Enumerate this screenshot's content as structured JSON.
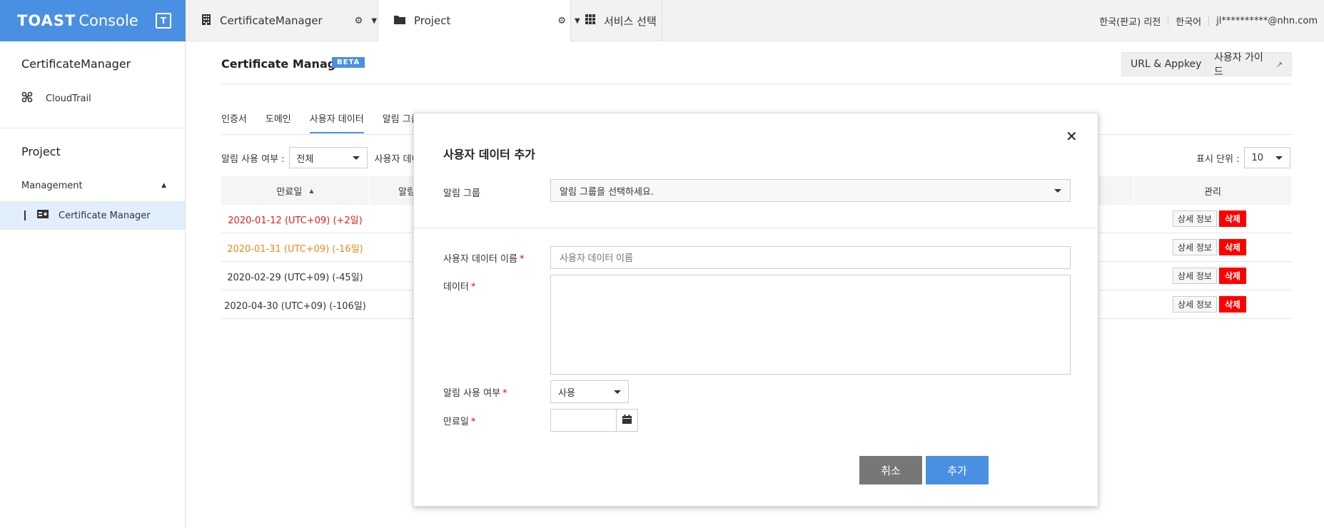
{
  "topbar": {
    "logo_toast": "TOAST",
    "logo_console": "Console",
    "logo_badge": "T",
    "tabs": [
      {
        "label": "CertificateManager",
        "icon": "building-icon"
      },
      {
        "label": "Project",
        "icon": "folder-icon"
      },
      {
        "label": "서비스 선택",
        "icon": "grid-icon"
      }
    ],
    "region": "한국(판교) 리전",
    "language": "한국어",
    "user": "jl**********@nhn.com"
  },
  "sidebar": {
    "section1_title": "CertificateManager",
    "cloudtrail": "CloudTrail",
    "section2_title": "Project",
    "management": "Management",
    "cert_manager": "Certificate Manager"
  },
  "main": {
    "title": "Certificate Manager",
    "beta": "BETA",
    "url_appkey": "URL & Appkey",
    "user_guide": "사용자 가이드",
    "tabs": [
      "인증서",
      "도메인",
      "사용자 데이터",
      "알림 그룹"
    ],
    "filter_label": "알림 사용 여부 :",
    "filter_value": "전체",
    "filter2_label": "사용자 데이터",
    "display_label": "표시 단위 :",
    "display_value": "10",
    "col_expire": "만료일",
    "col_alert": "알림",
    "col_manage": "관리",
    "rows": [
      {
        "date": "2020-01-12 (UTC+09) (+2일)",
        "color": "#e02020"
      },
      {
        "date": "2020-01-31 (UTC+09) (-16일)",
        "color": "#f0861d"
      },
      {
        "date": "2020-02-29 (UTC+09) (-45일)",
        "color": "#333333"
      },
      {
        "date": "2020-04-30 (UTC+09) (-106일)",
        "color": "#333333"
      }
    ],
    "detail_btn": "상세 정보",
    "delete_btn": "삭제"
  },
  "modal": {
    "title": "사용자 데이터 추가",
    "alert_group_label": "알림 그룹",
    "alert_group_placeholder": "알림 그룹을 선택하세요.",
    "name_label": "사용자 데이터 이름",
    "name_placeholder": "사용자 데이터 이름",
    "data_label": "데이터",
    "alert_use_label": "알림 사용 여부",
    "alert_use_value": "사용",
    "expire_label": "만료일",
    "cancel": "취소",
    "add": "추가",
    "required_mark": "*"
  }
}
